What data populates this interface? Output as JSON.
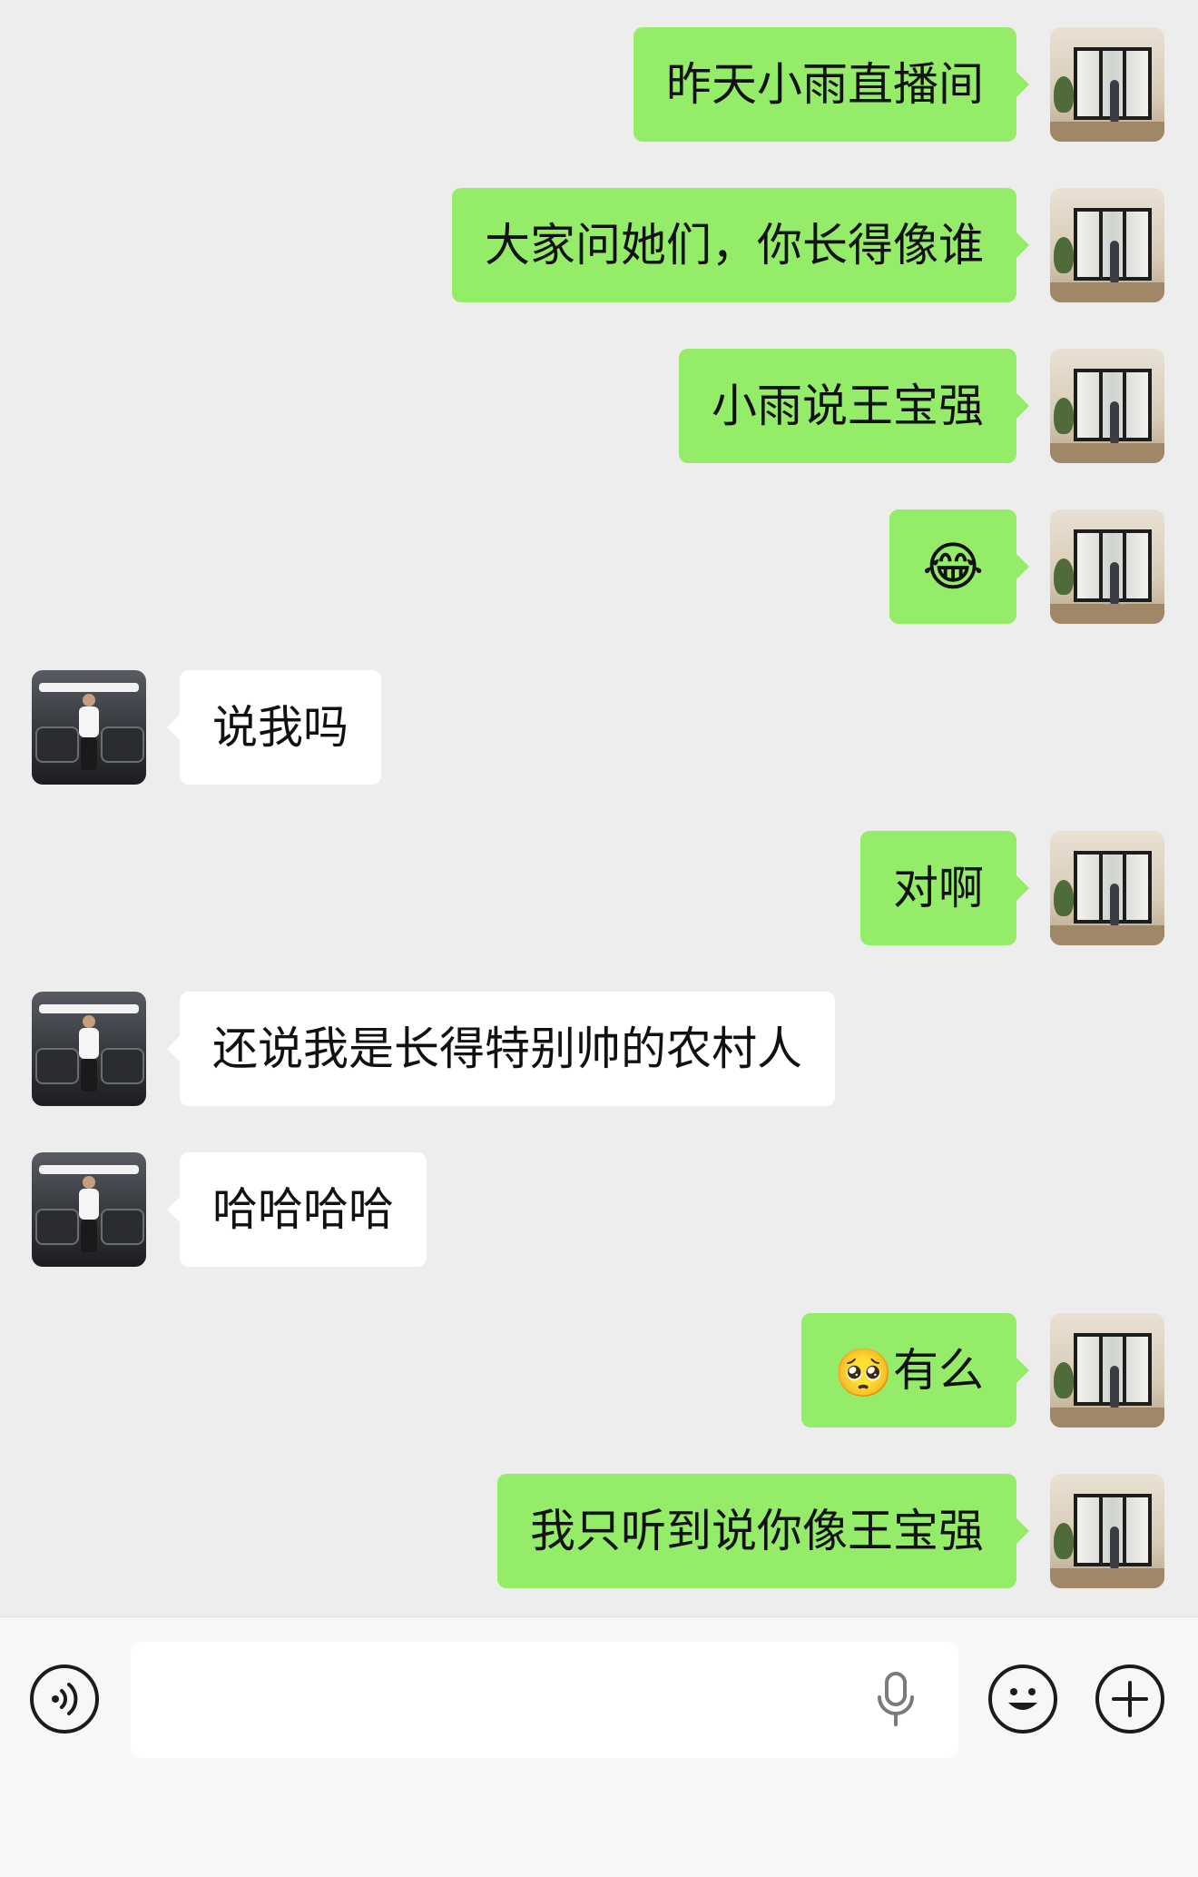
{
  "colors": {
    "background": "#ededed",
    "my_bubble": "#95ec69",
    "their_bubble": "#ffffff",
    "input_bar": "#f7f7f7"
  },
  "messages": [
    {
      "sender": "me",
      "text": "昨天小雨直播间"
    },
    {
      "sender": "me",
      "text": "大家问她们，你长得像谁"
    },
    {
      "sender": "me",
      "text": "小雨说王宝强"
    },
    {
      "sender": "me",
      "emoji": "😂"
    },
    {
      "sender": "other",
      "text": "说我吗"
    },
    {
      "sender": "me",
      "text": "对啊"
    },
    {
      "sender": "other",
      "text": "还说我是长得特别帅的农村人"
    },
    {
      "sender": "other",
      "text": "哈哈哈哈"
    },
    {
      "sender": "me",
      "emoji": "🥺",
      "text": "有么"
    },
    {
      "sender": "me",
      "text": "我只听到说你像王宝强"
    }
  ],
  "input_bar": {
    "voice_icon": "voice-icon",
    "input_value": "",
    "mic_icon": "mic-icon",
    "emoji_icon": "smiley-icon",
    "plus_icon": "plus-icon"
  }
}
